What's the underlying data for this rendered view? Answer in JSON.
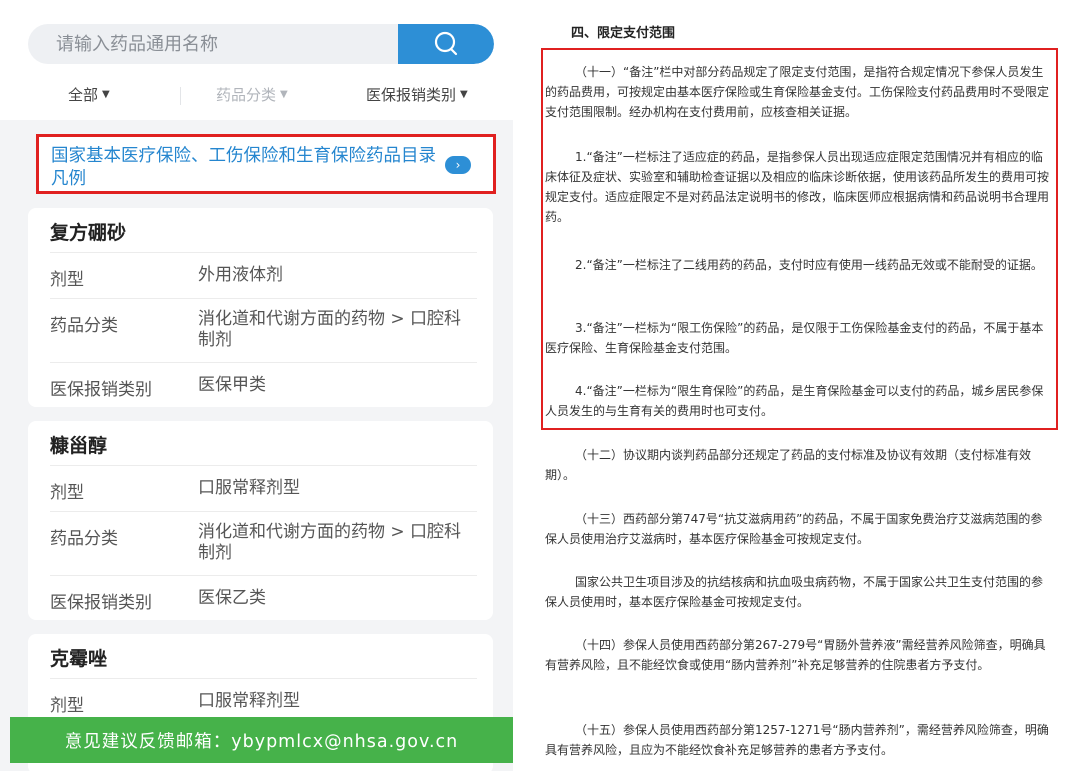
{
  "app": {
    "search": {
      "placeholder": "请输入药品通用名称"
    },
    "filters": [
      {
        "label": "全部"
      },
      {
        "label": "药品分类"
      },
      {
        "label": "医保报销类别"
      }
    ],
    "notice": {
      "text": "国家基本医疗保险、工伤保险和生育保险药品目录凡例"
    },
    "drugs": [
      {
        "name": "复方硼砂",
        "rows": [
          {
            "label": "剂型",
            "value": "外用液体剂"
          },
          {
            "label": "药品分类",
            "value": "消化道和代谢方面的药物 > 口腔科制剂"
          },
          {
            "label": "医保报销类别",
            "value": "医保甲类"
          }
        ]
      },
      {
        "name": "糠甾醇",
        "rows": [
          {
            "label": "剂型",
            "value": "口服常释剂型"
          },
          {
            "label": "药品分类",
            "value": "消化道和代谢方面的药物 > 口腔科制剂"
          },
          {
            "label": "医保报销类别",
            "value": "医保乙类"
          }
        ]
      },
      {
        "name": "克霉唑",
        "rows": [
          {
            "label": "剂型",
            "value": "口服常释剂型"
          }
        ]
      }
    ],
    "feedback": "意见建议反馈邮箱：ybypmlcx@nhsa.gov.cn",
    "colors": {
      "accent": "#2d8fd6",
      "highlight": "#e02020",
      "feedback_bar": "#46b24a"
    }
  },
  "doc": {
    "heading": "四、限定支付范围",
    "highlighted": [
      "（十一）“备注”栏中对部分药品规定了限定支付范围，是指符合规定情况下参保人员发生的药品费用，可按规定由基本医疗保险或生育保险基金支付。工伤保险支付药品费用时不受限定支付范围限制。经办机构在支付费用前，应核查相关证据。",
      "1.“备注”一栏标注了适应症的药品，是指参保人员出现适应症限定范围情况并有相应的临床体征及症状、实验室和辅助检查证据以及相应的临床诊断依据，使用该药品所发生的费用可按规定支付。适应症限定不是对药品法定说明书的修改，临床医师应根据病情和药品说明书合理用药。",
      "2.“备注”一栏标注了二线用药的药品，支付时应有使用一线药品无效或不能耐受的证据。",
      "3.“备注”一栏标为“限工伤保险”的药品，是仅限于工伤保险基金支付的药品，不属于基本医疗保险、生育保险基金支付范围。",
      "4.“备注”一栏标为“限生育保险”的药品，是生育保险基金可以支付的药品，城乡居民参保人员发生的与生育有关的费用时也可支付。"
    ],
    "paragraphs": [
      "（十二）协议期内谈判药品部分还规定了药品的支付标准及协议有效期（支付标准有效期）。",
      "（十三）西药部分第747号“抗艾滋病用药”的药品，不属于国家免费治疗艾滋病范围的参保人员使用治疗艾滋病时，基本医疗保险基金可按规定支付。",
      "国家公共卫生项目涉及的抗结核病和抗血吸虫病药物，不属于国家公共卫生支付范围的参保人员使用时，基本医疗保险基金可按规定支付。",
      "（十四）参保人员使用西药部分第267-279号“胃肠外营养液”需经营养风险筛查，明确具有营养风险，且不能经饮食或使用“肠内营养剂”补充足够营养的住院患者方予支付。",
      "（十五）参保人员使用西药部分第1257-1271号“肠内营养剂”，需经营养风险筛查，明确具有营养风险，且应为不能经饮食补充足够营养的患者方予支付。"
    ]
  }
}
